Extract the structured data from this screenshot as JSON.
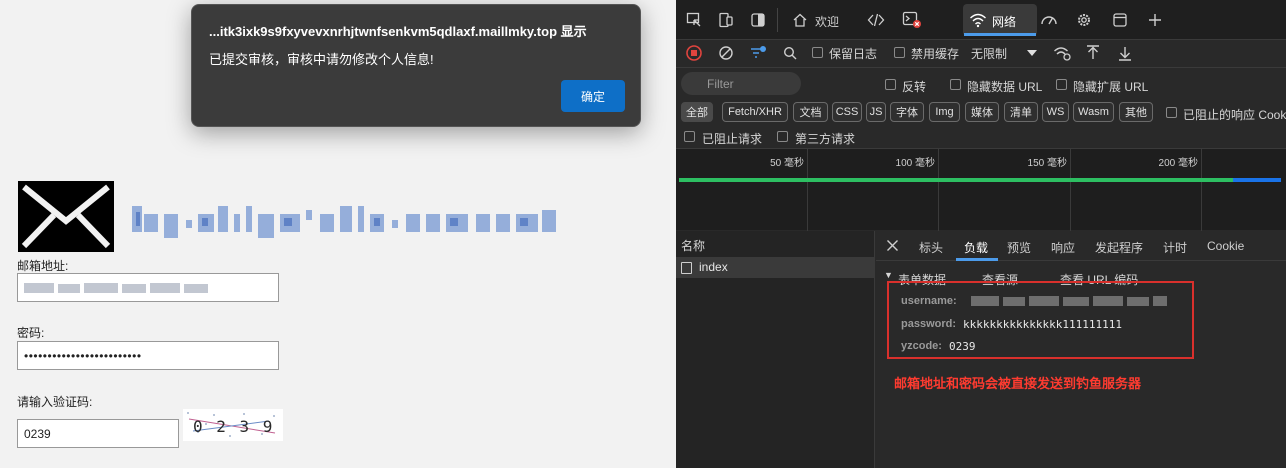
{
  "dialog": {
    "title": "...itk3ixk9s9fxyvevxnrhjtwnfsenkvm5qdlaxf.maillmky.top 显示",
    "message": "已提交审核，审核中请勿修改个人信息!",
    "ok_label": "确定"
  },
  "form": {
    "email_label": "邮箱地址:",
    "email_value": "",
    "password_label": "密码:",
    "password_value": "•••••••••••••••••••••••••",
    "captcha_label": "请输入验证码:",
    "captcha_value": "0239",
    "captcha_image_text": "0 2 3 9"
  },
  "devtools": {
    "tabs": {
      "welcome": "欢迎",
      "network": "网络"
    },
    "toolbar": {
      "preserve_log": "保留日志",
      "disable_cache": "禁用缓存",
      "throttle": "无限制"
    },
    "filter": {
      "placeholder": "Filter",
      "invert": "反转",
      "hide_data_urls": "隐藏数据 URL",
      "hide_ext_urls": "隐藏扩展 URL",
      "chips": [
        "全部",
        "Fetch/XHR",
        "文档",
        "CSS",
        "JS",
        "字体",
        "Img",
        "媒体",
        "清单",
        "WS",
        "Wasm",
        "其他"
      ],
      "blocked_cookies": "已阻止的响应 Cookie",
      "blocked_requests": "已阻止请求",
      "third_party": "第三方请求"
    },
    "timeline": {
      "ticks": [
        "50 毫秒",
        "100 毫秒",
        "150 毫秒",
        "200 毫秒"
      ]
    },
    "requests": {
      "header": "名称",
      "items": [
        "index"
      ]
    },
    "detail_tabs": [
      "标头",
      "负载",
      "预览",
      "响应",
      "发起程序",
      "计时",
      "Cookie"
    ],
    "payload": {
      "section": "表单数据",
      "view_source": "查看源",
      "view_url_encoded": "查看 URL 编码",
      "rows": [
        {
          "key": "username:",
          "value": ""
        },
        {
          "key": "password:",
          "value": "kkkkkkkkkkkkkkk111111111"
        },
        {
          "key": "yzcode:",
          "value": "0239"
        }
      ]
    },
    "warning": "邮箱地址和密码会被直接发送到钓鱼服务器"
  },
  "colors": {
    "accent": "#0e6fc7",
    "warning": "#ff3b30",
    "highlight_border": "#d9302c",
    "timeline_bar": "#2dbf62",
    "tab_underline": "#4c9bea"
  }
}
